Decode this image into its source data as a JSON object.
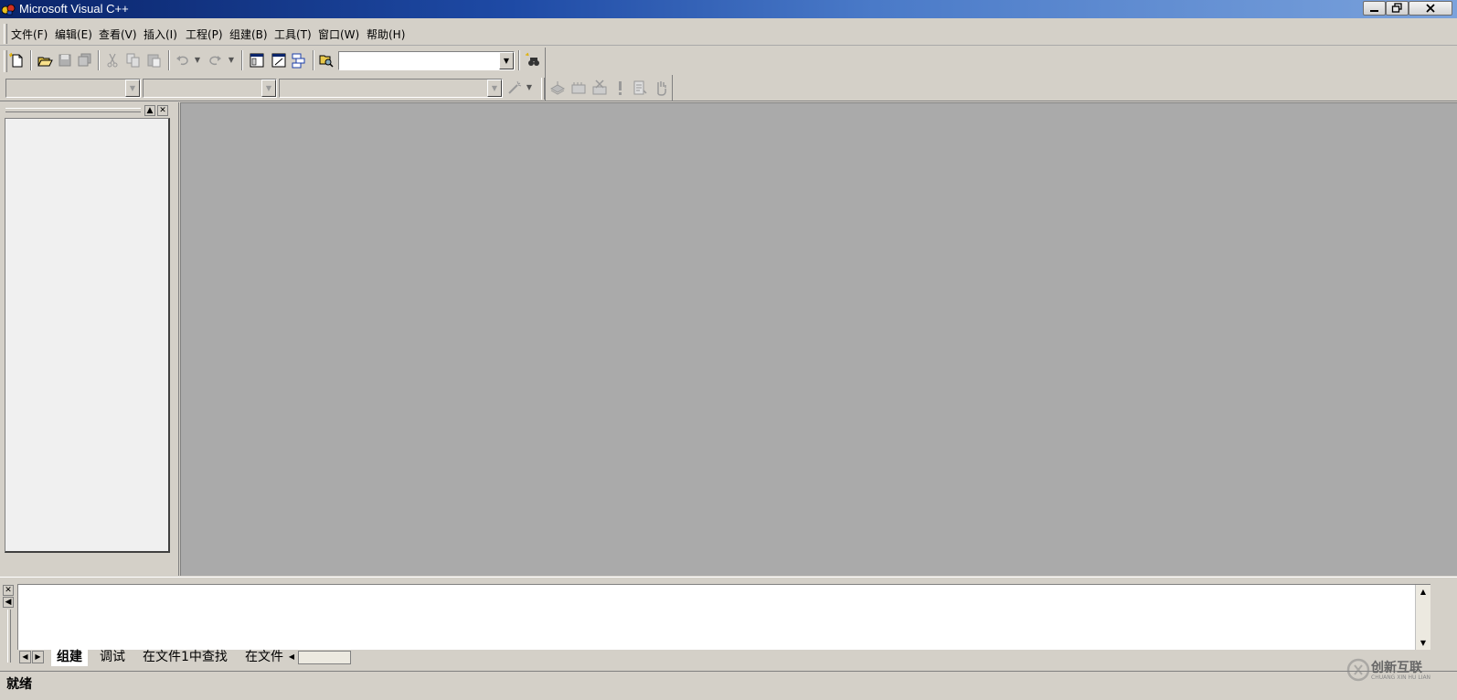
{
  "window": {
    "title": "Microsoft Visual C++",
    "controls": {
      "minimize": "—",
      "maximize": "▣",
      "close": "✕"
    }
  },
  "menu": {
    "items": [
      "文件(F)",
      "编辑(E)",
      "查看(V)",
      "插入(I)",
      "工程(P)",
      "组建(B)",
      "工具(T)",
      "窗口(W)",
      "帮助(H)"
    ]
  },
  "toolbar_standard": {
    "find_combo_value": ""
  },
  "toolbar_wizard": {
    "class_combo_value": "",
    "filter_combo_value": "",
    "members_combo_value": ""
  },
  "output": {
    "tabs": [
      "组建",
      "调试",
      "在文件1中查找",
      "在文件"
    ]
  },
  "status": {
    "text": "就绪"
  },
  "watermark": {
    "text": "创新互联",
    "sub": "CHUANG XIN HU LIAN"
  },
  "icons": {
    "new": "new-file-icon",
    "open": "open-folder-icon",
    "save": "save-icon",
    "save_all": "save-all-icon",
    "cut": "cut-icon",
    "copy": "copy-icon",
    "paste": "paste-icon",
    "undo": "undo-icon",
    "redo": "redo-icon",
    "workspace": "workspace-icon",
    "output": "output-icon",
    "window_list": "window-list-icon",
    "find_in_files": "find-in-files-icon",
    "search": "search-icon",
    "wizard": "wizard-icon",
    "compile": "compile-icon",
    "build": "build-icon",
    "stop_build": "stop-build-icon",
    "execute": "execute-icon",
    "breakpoint": "breakpoint-icon",
    "go": "go-icon"
  }
}
